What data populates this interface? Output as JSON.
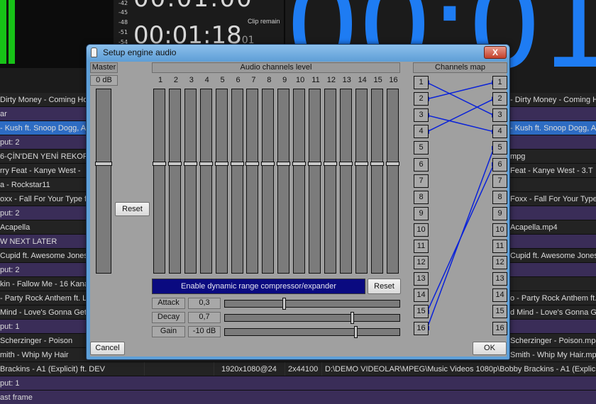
{
  "background": {
    "db_labels": [
      "-42",
      "-45",
      "-48",
      "-51",
      "-54"
    ],
    "clip_remain_label": "Clip remain",
    "clip_remain_time": "00:01:18",
    "clip_remain_frames": "01",
    "top_clock": "00:01:00",
    "big_timer": "00:01",
    "left_column_rows": [
      "Dirty Money - Coming Ho",
      "ar",
      "- Kush ft. Snoop Dogg, A",
      "put: 2",
      "6-ÇİN'DEN YENİ REKOR",
      "rry Feat  - Kanye West -",
      "a - Rockstar11",
      "oxx - Fall For Your Type f",
      "put: 2",
      "Acapella",
      "W NEXT LATER",
      "Cupid ft. Awesome Jones",
      "put: 2",
      "kin - Fallow Me - 16 Kana",
      "- Party Rock Anthem ft. L",
      "Mind - Love's Gonna Get",
      "put: 1",
      "Scherzinger - Poison",
      "mith - Whip My Hair",
      "Brackins - A1 (Explicit) ft. DEV",
      "put: 1",
      "ast frame"
    ],
    "right_column_rows": [
      "- Dirty Money - Coming Ho",
      "",
      "- Kush ft. Snoop Dogg, A",
      "",
      "mpg",
      "Feat  - Kanye West - 3.T",
      "",
      "Foxx - Fall For Your Type",
      "",
      "Acapella.mp4",
      "",
      "Cupid ft. Awesome Jones",
      "",
      "",
      "o - Party Rock Anthem ft.",
      "d Mind - Love's Gonna Ge",
      "",
      "Scherzinger - Poison.mp4",
      "Smith - Whip My Hair.mp4",
      "",
      "",
      ""
    ],
    "detail_row": {
      "resolution": "1920x1080@24",
      "audio": "2x44100",
      "path": "D:\\DEMO VIDEOLAR\\MPEG\\Music Videos 1080p\\Bobby Brackins - A1 (Explicit) ft. DEV"
    }
  },
  "dialog": {
    "title": "Setup engine audio",
    "close_label": "X",
    "master": {
      "header": "Master",
      "value": "0 dB",
      "reset_label": "Reset",
      "level": 0.6
    },
    "channels": {
      "header": "Audio channels level",
      "numbers": [
        "1",
        "2",
        "3",
        "4",
        "5",
        "6",
        "7",
        "8",
        "9",
        "10",
        "11",
        "12",
        "13",
        "14",
        "15",
        "16"
      ],
      "level": 0.6
    },
    "compressor_button": "Enable dynamic range compressor/expander",
    "compressor_reset_label": "Reset",
    "params": [
      {
        "label": "Attack",
        "value": "0,3",
        "position": 0.33
      },
      {
        "label": "Decay",
        "value": "0,7",
        "position": 0.72
      },
      {
        "label": "Gain",
        "value": "-10 dB",
        "position": 0.74
      }
    ],
    "channels_map": {
      "header": "Channels map",
      "inputs": [
        "1",
        "2",
        "3",
        "4",
        "5",
        "6",
        "7",
        "8",
        "9",
        "10",
        "11",
        "12",
        "13",
        "14",
        "15",
        "16"
      ],
      "outputs": [
        "1",
        "2",
        "3",
        "4",
        "5",
        "6",
        "7",
        "8",
        "9",
        "10",
        "11",
        "12",
        "13",
        "14",
        "15",
        "16"
      ],
      "links": [
        [
          1,
          3
        ],
        [
          2,
          1
        ],
        [
          3,
          4
        ],
        [
          4,
          2
        ],
        [
          15,
          6
        ],
        [
          16,
          5
        ]
      ]
    },
    "cancel_label": "Cancel",
    "ok_label": "OK"
  }
}
